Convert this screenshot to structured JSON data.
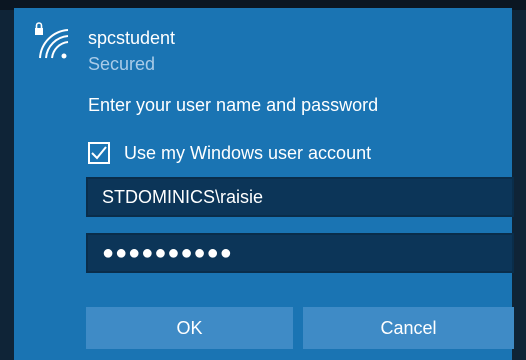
{
  "network": {
    "name": "spcstudent",
    "status": "Secured",
    "icon": "wifi-secured-icon"
  },
  "form": {
    "prompt": "Enter your user name and password",
    "use_windows_account": {
      "label": "Use my Windows user account",
      "checked": true
    },
    "username": {
      "value": "STDOMINICS\\raisie"
    },
    "password": {
      "masked_value": "●●●●●●●●●●"
    }
  },
  "buttons": {
    "ok_label": "OK",
    "cancel_label": "Cancel"
  },
  "colors": {
    "panel": "#1a74b3",
    "field": "#0c3558",
    "button": "#3f8bc6",
    "secondary_text": "#a9cbe8"
  }
}
